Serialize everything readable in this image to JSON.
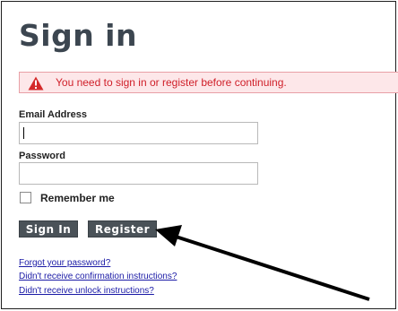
{
  "page": {
    "title": "Sign in"
  },
  "alert": {
    "icon": "warning-triangle-icon",
    "message": "You need to sign in or register before continuing."
  },
  "form": {
    "email_label": "Email Address",
    "email_value": "",
    "password_label": "Password",
    "password_value": "",
    "remember_label": "Remember me",
    "remember_checked": false,
    "sign_in_label": "Sign In",
    "register_label": "Register"
  },
  "links": [
    "Forgot your password?",
    "Didn't receive confirmation instructions?",
    "Didn't receive unlock instructions?"
  ],
  "colors": {
    "title": "#3c4650",
    "alert_text": "#d0202a",
    "alert_bg": "#fde7e9",
    "button_bg": "#4a5258",
    "link": "#1a1aa6"
  }
}
